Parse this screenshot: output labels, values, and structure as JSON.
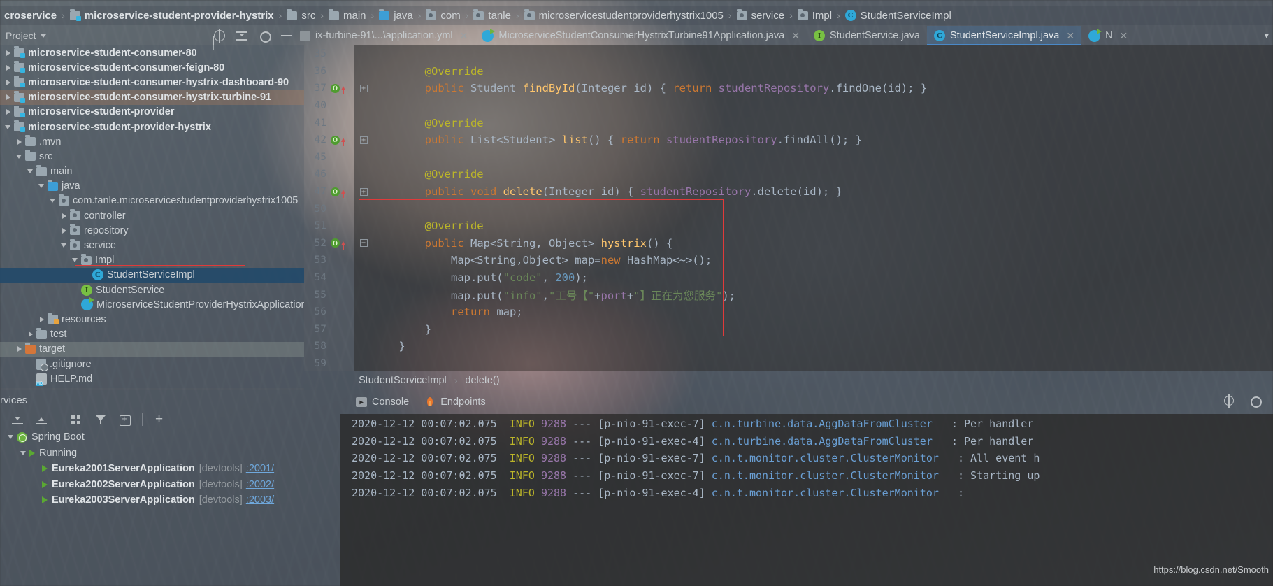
{
  "navbar": {
    "crumbs": [
      {
        "label": "croservice",
        "icon": "none",
        "bold": true
      },
      {
        "label": "microservice-student-provider-hystrix",
        "icon": "module-folder-icon",
        "bold": true
      },
      {
        "label": "src",
        "icon": "folder-icon",
        "bold": false
      },
      {
        "label": "main",
        "icon": "folder-icon",
        "bold": false
      },
      {
        "label": "java",
        "icon": "source-folder-icon",
        "bold": false
      },
      {
        "label": "com",
        "icon": "package-icon",
        "bold": false
      },
      {
        "label": "tanle",
        "icon": "package-icon",
        "bold": false
      },
      {
        "label": "microservicestudentproviderhystrix1005",
        "icon": "package-icon",
        "bold": false
      },
      {
        "label": "service",
        "icon": "package-icon",
        "bold": false
      },
      {
        "label": "Impl",
        "icon": "package-icon",
        "bold": false
      },
      {
        "label": "StudentServiceImpl",
        "icon": "class-icon",
        "bold": false
      }
    ]
  },
  "toolwindow": {
    "project_label": "Project",
    "icons": [
      "locate-icon",
      "collapse-all-icon",
      "gear-icon",
      "hide-icon"
    ]
  },
  "tabs": [
    {
      "label": "ix-turbine-91\\...\\application.yml",
      "icon": "yml-icon",
      "active": false,
      "closable": true
    },
    {
      "label": "MicroserviceStudentConsumerHystrixTurbine91Application.java",
      "icon": "spring-class-icon",
      "active": false,
      "closable": true
    },
    {
      "label": "StudentService.java",
      "icon": "interface-icon",
      "active": false,
      "closable": false
    },
    {
      "label": "StudentServiceImpl.java",
      "icon": "class-icon",
      "active": true,
      "closable": true
    },
    {
      "label": "N",
      "icon": "spring-class-icon",
      "active": false,
      "closable": true
    }
  ],
  "tree": [
    {
      "label": "microservice-student-consumer-80",
      "indent": 0,
      "twisty": "right",
      "icon": "module-folder-icon",
      "bold": true,
      "state": "normal"
    },
    {
      "label": "microservice-student-consumer-feign-80",
      "indent": 0,
      "twisty": "right",
      "icon": "module-folder-icon",
      "bold": true,
      "state": "normal"
    },
    {
      "label": "microservice-student-consumer-hystrix-dashboard-90",
      "indent": 0,
      "twisty": "right",
      "icon": "module-folder-icon",
      "bold": true,
      "state": "normal"
    },
    {
      "label": "microservice-student-consumer-hystrix-turbine-91",
      "indent": 0,
      "twisty": "right",
      "icon": "module-folder-icon",
      "bold": true,
      "state": "highlight"
    },
    {
      "label": "microservice-student-provider",
      "indent": 0,
      "twisty": "right",
      "icon": "module-folder-icon",
      "bold": true,
      "state": "normal"
    },
    {
      "label": "microservice-student-provider-hystrix",
      "indent": 0,
      "twisty": "down",
      "icon": "module-folder-icon",
      "bold": true,
      "state": "normal"
    },
    {
      "label": ".mvn",
      "indent": 1,
      "twisty": "right",
      "icon": "folder-icon",
      "bold": false,
      "state": "normal"
    },
    {
      "label": "src",
      "indent": 1,
      "twisty": "down",
      "icon": "folder-icon",
      "bold": false,
      "state": "normal"
    },
    {
      "label": "main",
      "indent": 2,
      "twisty": "down",
      "icon": "folder-icon",
      "bold": false,
      "state": "normal"
    },
    {
      "label": "java",
      "indent": 3,
      "twisty": "down",
      "icon": "source-folder-icon",
      "bold": false,
      "state": "normal"
    },
    {
      "label": "com.tanle.microservicestudentproviderhystrix1005",
      "indent": 4,
      "twisty": "down",
      "icon": "package-icon",
      "bold": false,
      "state": "normal"
    },
    {
      "label": "controller",
      "indent": 5,
      "twisty": "right",
      "icon": "package-icon",
      "bold": false,
      "state": "normal"
    },
    {
      "label": "repository",
      "indent": 5,
      "twisty": "right",
      "icon": "package-icon",
      "bold": false,
      "state": "normal"
    },
    {
      "label": "service",
      "indent": 5,
      "twisty": "down",
      "icon": "package-icon",
      "bold": false,
      "state": "normal"
    },
    {
      "label": "Impl",
      "indent": 6,
      "twisty": "down",
      "icon": "package-icon",
      "bold": false,
      "state": "normal"
    },
    {
      "label": "StudentServiceImpl",
      "indent": 7,
      "twisty": "none",
      "icon": "class-icon",
      "bold": false,
      "state": "selected"
    },
    {
      "label": "StudentService",
      "indent": 6,
      "twisty": "none",
      "icon": "interface-icon",
      "bold": false,
      "state": "normal"
    },
    {
      "label": "MicroserviceStudentProviderHystrixApplication",
      "indent": 6,
      "twisty": "none",
      "icon": "spring-class-icon",
      "bold": false,
      "state": "normal"
    },
    {
      "label": "resources",
      "indent": 3,
      "twisty": "right",
      "icon": "resources-folder-icon",
      "bold": false,
      "state": "normal"
    },
    {
      "label": "test",
      "indent": 2,
      "twisty": "right",
      "icon": "folder-icon",
      "bold": false,
      "state": "normal"
    },
    {
      "label": "target",
      "indent": 1,
      "twisty": "right",
      "icon": "target-folder-icon",
      "bold": false,
      "state": "highlight2"
    },
    {
      "label": ".gitignore",
      "indent": 2,
      "twisty": "none",
      "icon": "gitignore-icon",
      "bold": false,
      "state": "normal"
    },
    {
      "label": "HELP.md",
      "indent": 2,
      "twisty": "none",
      "icon": "markdown-icon",
      "bold": false,
      "state": "normal"
    }
  ],
  "editor": {
    "lines": [
      {
        "num": "35",
        "gutter": [],
        "fold": "",
        "tokens": []
      },
      {
        "num": "36",
        "gutter": [],
        "fold": "",
        "tokens": [
          {
            "t": "        ",
            "c": "code"
          },
          {
            "t": "@Override",
            "c": "ann"
          }
        ]
      },
      {
        "num": "37",
        "gutter": [
          "override-icon",
          "up-arrow-icon"
        ],
        "fold": "plus",
        "tokens": [
          {
            "t": "        ",
            "c": "code"
          },
          {
            "t": "public ",
            "c": "kw"
          },
          {
            "t": "Student ",
            "c": "typ"
          },
          {
            "t": "findById",
            "c": "mth"
          },
          {
            "t": "(",
            "c": "code"
          },
          {
            "t": "Integer id",
            "c": "code"
          },
          {
            "t": ") { ",
            "c": "code"
          },
          {
            "t": "return ",
            "c": "kw"
          },
          {
            "t": "studentRepository",
            "c": "fld"
          },
          {
            "t": ".findOne(id); }",
            "c": "code"
          }
        ]
      },
      {
        "num": "40",
        "gutter": [],
        "fold": "",
        "tokens": []
      },
      {
        "num": "41",
        "gutter": [],
        "fold": "",
        "tokens": [
          {
            "t": "        ",
            "c": "code"
          },
          {
            "t": "@Override",
            "c": "ann"
          }
        ]
      },
      {
        "num": "42",
        "gutter": [
          "override-icon",
          "up-arrow-icon"
        ],
        "fold": "plus",
        "tokens": [
          {
            "t": "        ",
            "c": "code"
          },
          {
            "t": "public ",
            "c": "kw"
          },
          {
            "t": "List<Student> ",
            "c": "typ"
          },
          {
            "t": "list",
            "c": "mth"
          },
          {
            "t": "() { ",
            "c": "code"
          },
          {
            "t": "return ",
            "c": "kw"
          },
          {
            "t": "studentRepository",
            "c": "fld"
          },
          {
            "t": ".findAll(); }",
            "c": "code"
          }
        ]
      },
      {
        "num": "45",
        "gutter": [],
        "fold": "",
        "tokens": []
      },
      {
        "num": "46",
        "gutter": [],
        "fold": "",
        "tokens": [
          {
            "t": "        ",
            "c": "code"
          },
          {
            "t": "@Override",
            "c": "ann"
          }
        ]
      },
      {
        "num": "47",
        "gutter": [
          "override-icon",
          "up-arrow-icon"
        ],
        "fold": "plus",
        "tokens": [
          {
            "t": "        ",
            "c": "code"
          },
          {
            "t": "public ",
            "c": "kw"
          },
          {
            "t": "void ",
            "c": "kw"
          },
          {
            "t": "delete",
            "c": "mth"
          },
          {
            "t": "(Integer id",
            "c": "code"
          },
          {
            "t": ") { ",
            "c": "code"
          },
          {
            "t": "studentRepository",
            "c": "fld"
          },
          {
            "t": ".delete(id); }",
            "c": "code"
          }
        ]
      },
      {
        "num": "50",
        "gutter": [],
        "fold": "",
        "tokens": []
      },
      {
        "num": "51",
        "gutter": [],
        "fold": "",
        "tokens": [
          {
            "t": "        ",
            "c": "code"
          },
          {
            "t": "@Override",
            "c": "ann"
          }
        ]
      },
      {
        "num": "52",
        "gutter": [
          "override-icon",
          "up-arrow-icon"
        ],
        "fold": "minus",
        "tokens": [
          {
            "t": "        ",
            "c": "code"
          },
          {
            "t": "public ",
            "c": "kw"
          },
          {
            "t": "Map<String, Object> ",
            "c": "typ"
          },
          {
            "t": "hystrix",
            "c": "mth"
          },
          {
            "t": "() {",
            "c": "code"
          }
        ]
      },
      {
        "num": "53",
        "gutter": [],
        "fold": "",
        "tokens": [
          {
            "t": "            Map<String,Object> map=",
            "c": "code"
          },
          {
            "t": "new ",
            "c": "kw"
          },
          {
            "t": "HashMap<~>();",
            "c": "code"
          }
        ]
      },
      {
        "num": "54",
        "gutter": [],
        "fold": "",
        "tokens": [
          {
            "t": "            map.put(",
            "c": "code"
          },
          {
            "t": "\"code\"",
            "c": "str"
          },
          {
            "t": ", ",
            "c": "code"
          },
          {
            "t": "200",
            "c": "num"
          },
          {
            "t": ");",
            "c": "code"
          }
        ]
      },
      {
        "num": "55",
        "gutter": [],
        "fold": "",
        "tokens": [
          {
            "t": "            map.put(",
            "c": "code"
          },
          {
            "t": "\"info\"",
            "c": "str"
          },
          {
            "t": ",",
            "c": "code"
          },
          {
            "t": "\"工号【\"",
            "c": "str"
          },
          {
            "t": "+",
            "c": "code"
          },
          {
            "t": "port",
            "c": "fld"
          },
          {
            "t": "+",
            "c": "code"
          },
          {
            "t": "\"】正在为您服务\"",
            "c": "str"
          },
          {
            "t": ");",
            "c": "code"
          }
        ]
      },
      {
        "num": "56",
        "gutter": [],
        "fold": "",
        "tokens": [
          {
            "t": "            ",
            "c": "code"
          },
          {
            "t": "return ",
            "c": "kw"
          },
          {
            "t": "map;",
            "c": "code"
          }
        ]
      },
      {
        "num": "57",
        "gutter": [],
        "fold": "",
        "tokens": [
          {
            "t": "        }",
            "c": "code"
          }
        ]
      },
      {
        "num": "58",
        "gutter": [],
        "fold": "",
        "tokens": [
          {
            "t": "    }",
            "c": "code"
          }
        ]
      },
      {
        "num": "59",
        "gutter": [],
        "fold": "",
        "tokens": []
      }
    ],
    "breadcrumb": [
      "StudentServiceImpl",
      "delete()"
    ]
  },
  "services": {
    "title": "rvices",
    "toolbar_icons": [
      "expand-all-icon",
      "collapse-all-icon",
      "group-icon",
      "filter-icon",
      "add-tab-icon",
      "add-icon"
    ],
    "rows": [
      {
        "label": "Spring Boot",
        "sub": "",
        "link": "",
        "indent": 0,
        "twisty": "down",
        "icon": "spring-icon",
        "bold": false
      },
      {
        "label": "Running",
        "sub": "",
        "link": "",
        "indent": 1,
        "twisty": "down",
        "icon": "run-icon",
        "bold": false
      },
      {
        "label": "Eureka2001ServerApplication",
        "sub": "[devtools]",
        "link": ":2001/",
        "indent": 2,
        "twisty": "none",
        "icon": "run-leaf-icon",
        "bold": true
      },
      {
        "label": "Eureka2002ServerApplication",
        "sub": "[devtools]",
        "link": ":2002/",
        "indent": 2,
        "twisty": "none",
        "icon": "run-leaf-icon",
        "bold": true
      },
      {
        "label": "Eureka2003ServerApplication",
        "sub": "[devtools]",
        "link": ":2003/",
        "indent": 2,
        "twisty": "none",
        "icon": "run-leaf-icon",
        "bold": true
      }
    ]
  },
  "console": {
    "tabs": [
      {
        "label": "Console",
        "icon": "console-icon"
      },
      {
        "label": "Endpoints",
        "icon": "endpoints-icon"
      }
    ],
    "lines": [
      {
        "ts": "2020-12-12 00:07:02.075",
        "level": "INFO",
        "pid": "9288",
        "thread": "[p-nio-91-exec-7]",
        "cls": "c.n.turbine.data.AggDataFromCluster",
        "msg": ": Per handler"
      },
      {
        "ts": "2020-12-12 00:07:02.075",
        "level": "INFO",
        "pid": "9288",
        "thread": "[p-nio-91-exec-4]",
        "cls": "c.n.turbine.data.AggDataFromCluster",
        "msg": ": Per handler"
      },
      {
        "ts": "2020-12-12 00:07:02.075",
        "level": "INFO",
        "pid": "9288",
        "thread": "[p-nio-91-exec-7]",
        "cls": "c.n.t.monitor.cluster.ClusterMonitor",
        "msg": ": All event h"
      },
      {
        "ts": "2020-12-12 00:07:02.075",
        "level": "INFO",
        "pid": "9288",
        "thread": "[p-nio-91-exec-7]",
        "cls": "c.n.t.monitor.cluster.ClusterMonitor",
        "msg": ": Starting up"
      },
      {
        "ts": "2020-12-12 00:07:02.075",
        "level": "INFO",
        "pid": "9288",
        "thread": "[p-nio-91-exec-4]",
        "cls": "c.n.t.monitor.cluster.ClusterMonitor",
        "msg": ":"
      }
    ]
  },
  "watermark": "https://blog.csdn.net/Smooth"
}
